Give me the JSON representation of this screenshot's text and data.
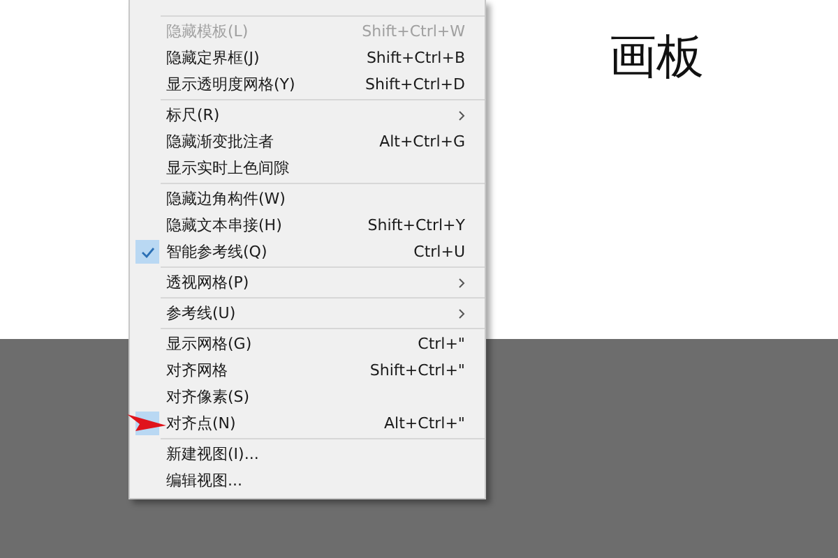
{
  "artboard_title": "画板",
  "menu": {
    "sections": [
      {
        "items": [
          {
            "label": "隐藏模板(L)",
            "shortcut": "Shift+Ctrl+W",
            "disabled": true,
            "checked": false,
            "submenu": false
          },
          {
            "label": "隐藏定界框(J)",
            "shortcut": "Shift+Ctrl+B",
            "disabled": false,
            "checked": false,
            "submenu": false
          },
          {
            "label": "显示透明度网格(Y)",
            "shortcut": "Shift+Ctrl+D",
            "disabled": false,
            "checked": false,
            "submenu": false
          }
        ]
      },
      {
        "items": [
          {
            "label": "标尺(R)",
            "disabled": false,
            "checked": false,
            "submenu": true
          },
          {
            "label": "隐藏渐变批注者",
            "shortcut": "Alt+Ctrl+G",
            "disabled": false,
            "checked": false,
            "submenu": false
          },
          {
            "label": "显示实时上色间隙",
            "disabled": false,
            "checked": false,
            "submenu": false
          }
        ]
      },
      {
        "items": [
          {
            "label": "隐藏边角构件(W)",
            "disabled": false,
            "checked": false,
            "submenu": false
          },
          {
            "label": "隐藏文本串接(H)",
            "shortcut": "Shift+Ctrl+Y",
            "disabled": false,
            "checked": false,
            "submenu": false
          },
          {
            "label": "智能参考线(Q)",
            "shortcut": "Ctrl+U",
            "disabled": false,
            "checked": true,
            "submenu": false
          }
        ]
      },
      {
        "items": [
          {
            "label": "透视网格(P)",
            "disabled": false,
            "checked": false,
            "submenu": true
          }
        ]
      },
      {
        "items": [
          {
            "label": "参考线(U)",
            "disabled": false,
            "checked": false,
            "submenu": true
          }
        ]
      },
      {
        "items": [
          {
            "label": "显示网格(G)",
            "shortcut": "Ctrl+\"",
            "disabled": false,
            "checked": false,
            "submenu": false
          },
          {
            "label": "对齐网格",
            "shortcut": "Shift+Ctrl+\"",
            "disabled": false,
            "checked": false,
            "submenu": false
          },
          {
            "label": "对齐像素(S)",
            "disabled": false,
            "checked": false,
            "submenu": false
          },
          {
            "label": "对齐点(N)",
            "shortcut": "Alt+Ctrl+\"",
            "disabled": false,
            "checked": true,
            "submenu": false,
            "pointer": true
          }
        ]
      },
      {
        "items": [
          {
            "label": "新建视图(I)...",
            "disabled": false,
            "checked": false,
            "submenu": false
          },
          {
            "label": "编辑视图...",
            "disabled": false,
            "checked": false,
            "submenu": false
          }
        ]
      }
    ]
  }
}
